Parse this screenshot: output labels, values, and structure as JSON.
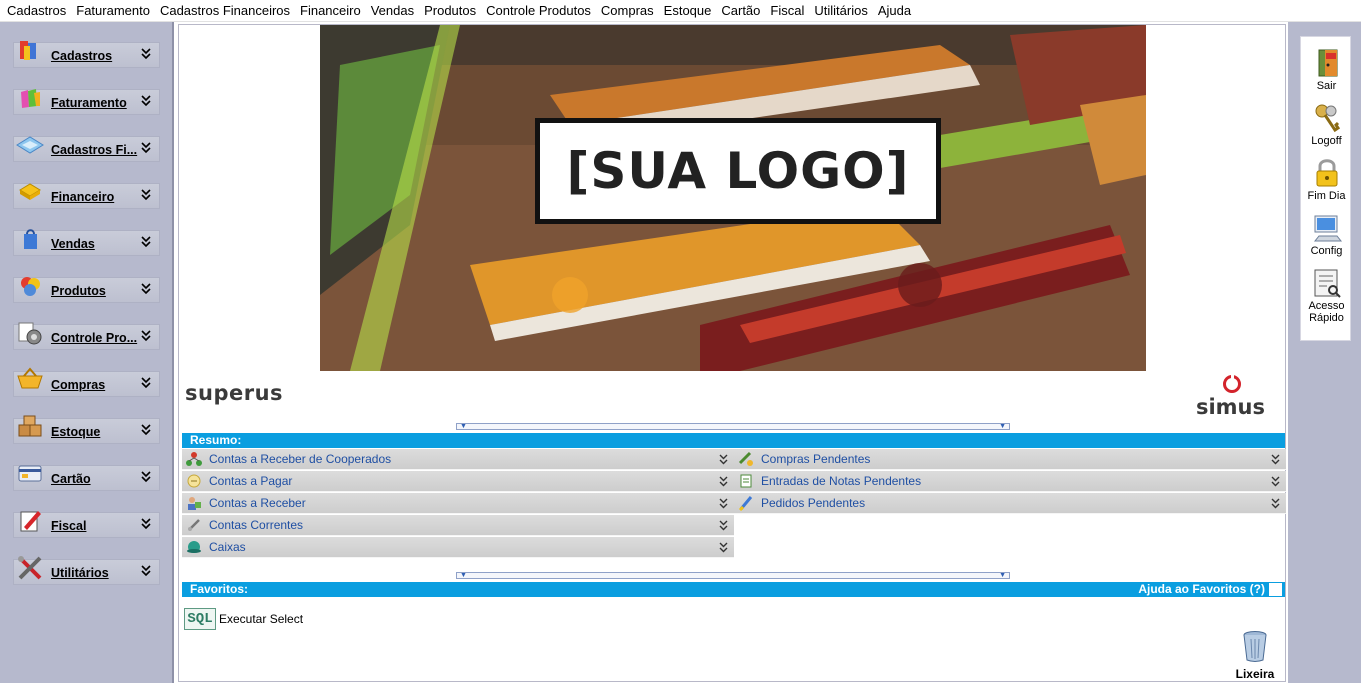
{
  "menu": [
    "Cadastros",
    "Faturamento",
    "Cadastros Financeiros",
    "Financeiro",
    "Vendas",
    "Produtos",
    "Controle Produtos",
    "Compras",
    "Estoque",
    "Cartão",
    "Fiscal",
    "Utilitários",
    "Ajuda"
  ],
  "sidebar": {
    "items": [
      {
        "label": "Cadastros",
        "icon": "cadastros-icon"
      },
      {
        "label": "Faturamento",
        "icon": "faturamento-icon"
      },
      {
        "label": "Cadastros Fi...",
        "icon": "cadastros-financeiros-icon"
      },
      {
        "label": "Financeiro",
        "icon": "financeiro-icon"
      },
      {
        "label": "Vendas",
        "icon": "vendas-icon"
      },
      {
        "label": "Produtos",
        "icon": "produtos-icon"
      },
      {
        "label": "Controle Pro...",
        "icon": "controle-produtos-icon"
      },
      {
        "label": "Compras",
        "icon": "compras-icon"
      },
      {
        "label": "Estoque",
        "icon": "estoque-icon"
      },
      {
        "label": "Cartão",
        "icon": "cartao-icon"
      },
      {
        "label": "Fiscal",
        "icon": "fiscal-icon"
      },
      {
        "label": "Utilitários",
        "icon": "utilitarios-icon"
      }
    ]
  },
  "banner": {
    "logo_text": "[SUA LOGO]"
  },
  "brands": {
    "left": "superus",
    "right": "simus"
  },
  "resumo": {
    "title": "Resumo:",
    "left_items": [
      "Contas a Receber de Cooperados",
      "Contas a Pagar",
      "Contas a Receber",
      "Contas Correntes",
      "Caixas"
    ],
    "right_items": [
      "Compras Pendentes",
      "Entradas de Notas Pendentes",
      "Pedidos Pendentes"
    ]
  },
  "favoritos": {
    "title": "Favoritos:",
    "help": "Ajuda ao Favoritos (?)",
    "sql_icon": "SQL",
    "items": [
      "Executar Select"
    ],
    "trash_label": "Lixeira"
  },
  "toolbar": {
    "items": [
      {
        "label": "Sair",
        "icon": "exit-door-icon"
      },
      {
        "label": "Logoff",
        "icon": "keys-icon"
      },
      {
        "label": "Fim Dia",
        "icon": "padlock-icon"
      },
      {
        "label": "Config",
        "icon": "computer-icon"
      },
      {
        "label": "Acesso\nRápido",
        "icon": "quick-access-icon"
      }
    ]
  },
  "colors": {
    "accent": "#0a9ee0",
    "sidebar": "#b6b9cd",
    "link": "#1f4fa3"
  }
}
